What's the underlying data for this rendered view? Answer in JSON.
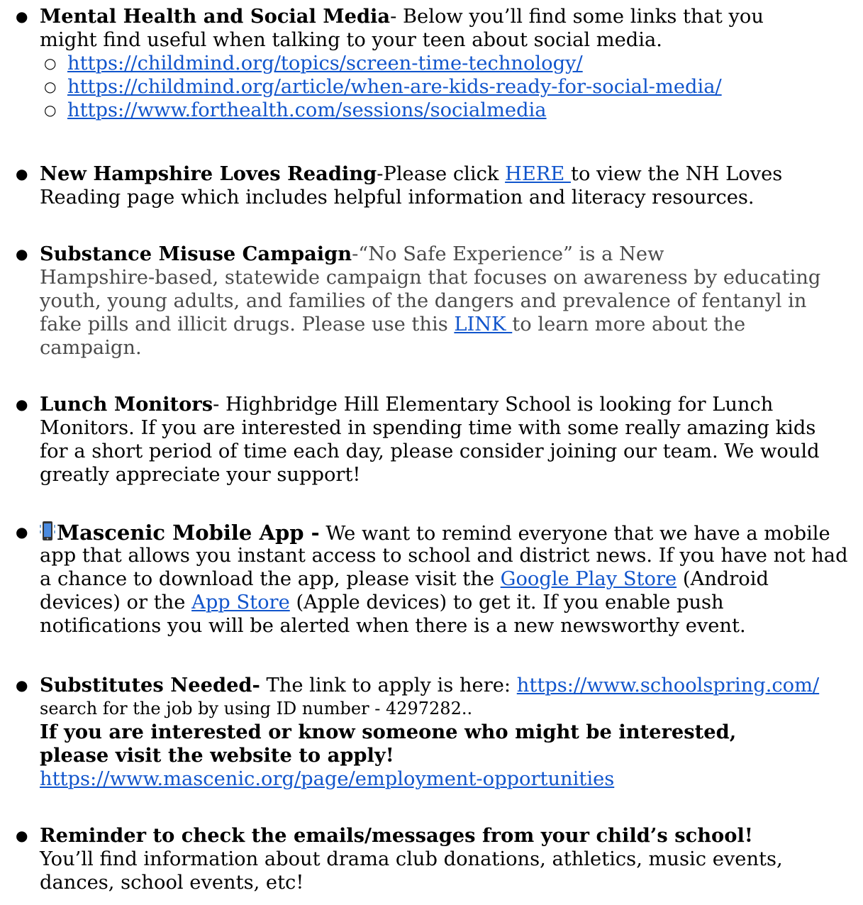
{
  "items": [
    {
      "title": "Mental Health and Social Media",
      "text_1": "- Below you’ll find some links that you",
      "text_2": "might find useful when talking to your teen about social media.",
      "links": [
        "https://childmind.org/topics/screen-time-technology/",
        "https://childmind.org/article/when-are-kids-ready-for-social-media/",
        "https://www.forthealth.com/sessions/socialmedia"
      ]
    },
    {
      "title": "New Hampshire Loves Reading",
      "text_1": "-Please click ",
      "link": "HERE ",
      "text_2": " to view the NH Loves",
      "text_3": "Reading page which includes helpful information and literacy resources."
    },
    {
      "title": "Substance Misuse Campaign",
      "text_1": "-“No Safe Experience” is a New",
      "text_2": "Hampshire-based, statewide campaign that focuses on awareness by educating",
      "text_3": "youth, young adults, and families of the dangers and prevalence of fentanyl in",
      "text_4": "fake pills and illicit drugs. Please use this ",
      "link": "LINK ",
      "text_5": "to learn more about the",
      "text_6": "campaign."
    },
    {
      "title": "Lunch Monitors",
      "text_1": "- Highbridge Hill Elementary School is looking for Lunch",
      "text_2": "Monitors. If you are interested in spending time with some really amazing kids",
      "text_3": "for a short period of time each day, please consider joining our team. We would",
      "text_4": "greatly appreciate your support!"
    },
    {
      "icon": "vibrating-phone-icon",
      "title": "Mascenic Mobile App -",
      "text_1": " We want to remind everyone that we have a mobile",
      "text_2": "app that allows you instant access to school and district news. If you have not had",
      "text_3": "a chance to download the app, please visit the ",
      "link_1": "Google Play Store",
      "text_4": " (Android",
      "text_5": "devices) or the ",
      "link_2": "App Store",
      "text_6": " (Apple devices) to get it. If you enable push",
      "text_7": "notifications you will be alerted when there is a new newsworthy event."
    },
    {
      "title": "Substitutes Needed-",
      "text_1": " The link to apply is here: ",
      "link_1": "https://www.schoolspring.com/",
      "text_2": "search for the job by using ID number - 4297282..",
      "bold_1": "If you are interested or know someone who might be interested,",
      "bold_2": "please visit the website to apply!",
      "link_2": "https://www.mascenic.org/page/employment-opportunities"
    },
    {
      "title": "Reminder to check the emails/messages from your child’s school!",
      "text_1": "You’ll find information about drama club donations, athletics, music events,",
      "text_2": "dances, school events, etc!"
    }
  ],
  "bullet_char": "●",
  "sub_bullet_char": "○",
  "colors": {
    "link": "#1155cc",
    "muted_text": "#4a4a4a"
  }
}
